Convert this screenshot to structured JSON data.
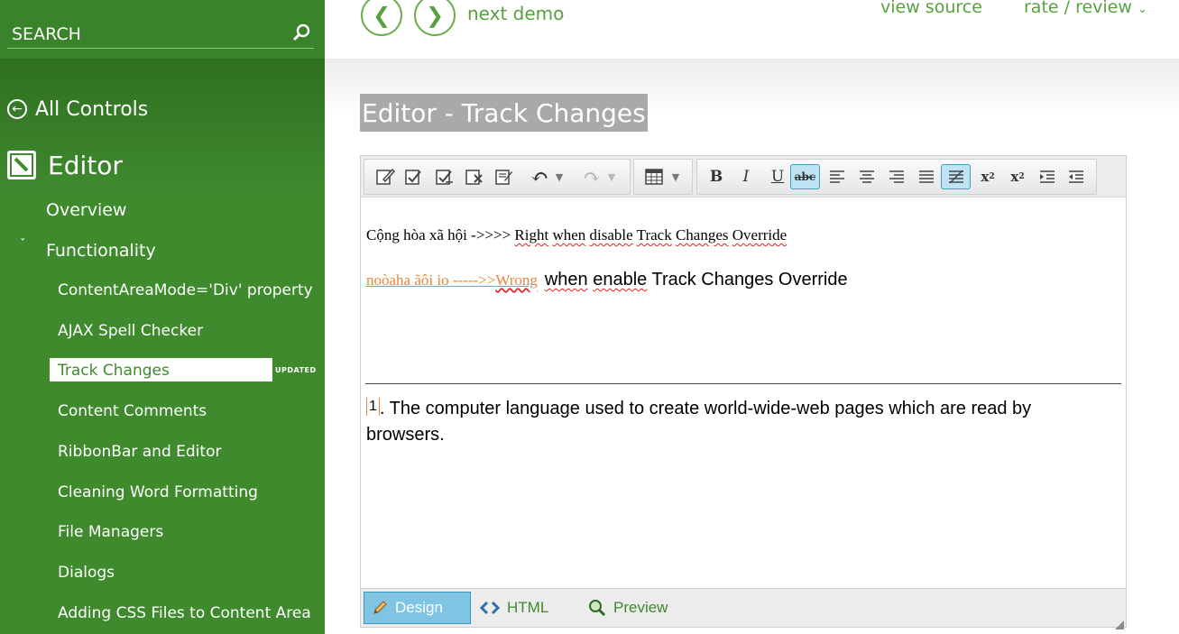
{
  "sidebar": {
    "search": {
      "placeholder": "SEARCH"
    },
    "all_controls": "All Controls",
    "section_title": "Editor",
    "items": [
      {
        "label": "Overview"
      },
      {
        "label": "Functionality"
      }
    ],
    "sub_items": [
      {
        "label": "ContentAreaMode='Div' property"
      },
      {
        "label": "AJAX Spell Checker"
      },
      {
        "label": "Track Changes",
        "badge": "UPDATED"
      },
      {
        "label": "Content Comments"
      },
      {
        "label": "RibbonBar and Editor"
      },
      {
        "label": "Cleaning Word Formatting"
      },
      {
        "label": "File Managers"
      },
      {
        "label": "Dialogs"
      },
      {
        "label": "Adding CSS Files to Content Area"
      }
    ]
  },
  "header": {
    "next_demo": "next demo",
    "view_source": "view source",
    "rate_review": "rate / review"
  },
  "page": {
    "title": "Editor - Track Changes"
  },
  "editor": {
    "content": {
      "line1_prefix": "Cộng hòa xã hội ->>>> ",
      "line1_w1": "Right",
      "line1_w2": "when",
      "line1_w3": "disable",
      "line1_w4": "Track",
      "line1_w5": "Changes",
      "line1_w6": "Override",
      "line2_tracked_a": "noòaha ãôi io ----->>",
      "line2_tracked_b": "Wrong",
      "line2_w1": "when",
      "line2_w2": "enable",
      "line2_rest": " Track Changes Override",
      "line3_num": "1",
      "line3_text": ". The computer language used to create world-wide-web pages which are read by browsers."
    },
    "modes": {
      "design": "Design",
      "html": "HTML",
      "preview": "Preview"
    }
  },
  "colors": {
    "sidebar": "#3e8a2c",
    "accent": "#5aa040",
    "tracked_change": "#e8853a",
    "active_tool": "#bfe3f3"
  }
}
